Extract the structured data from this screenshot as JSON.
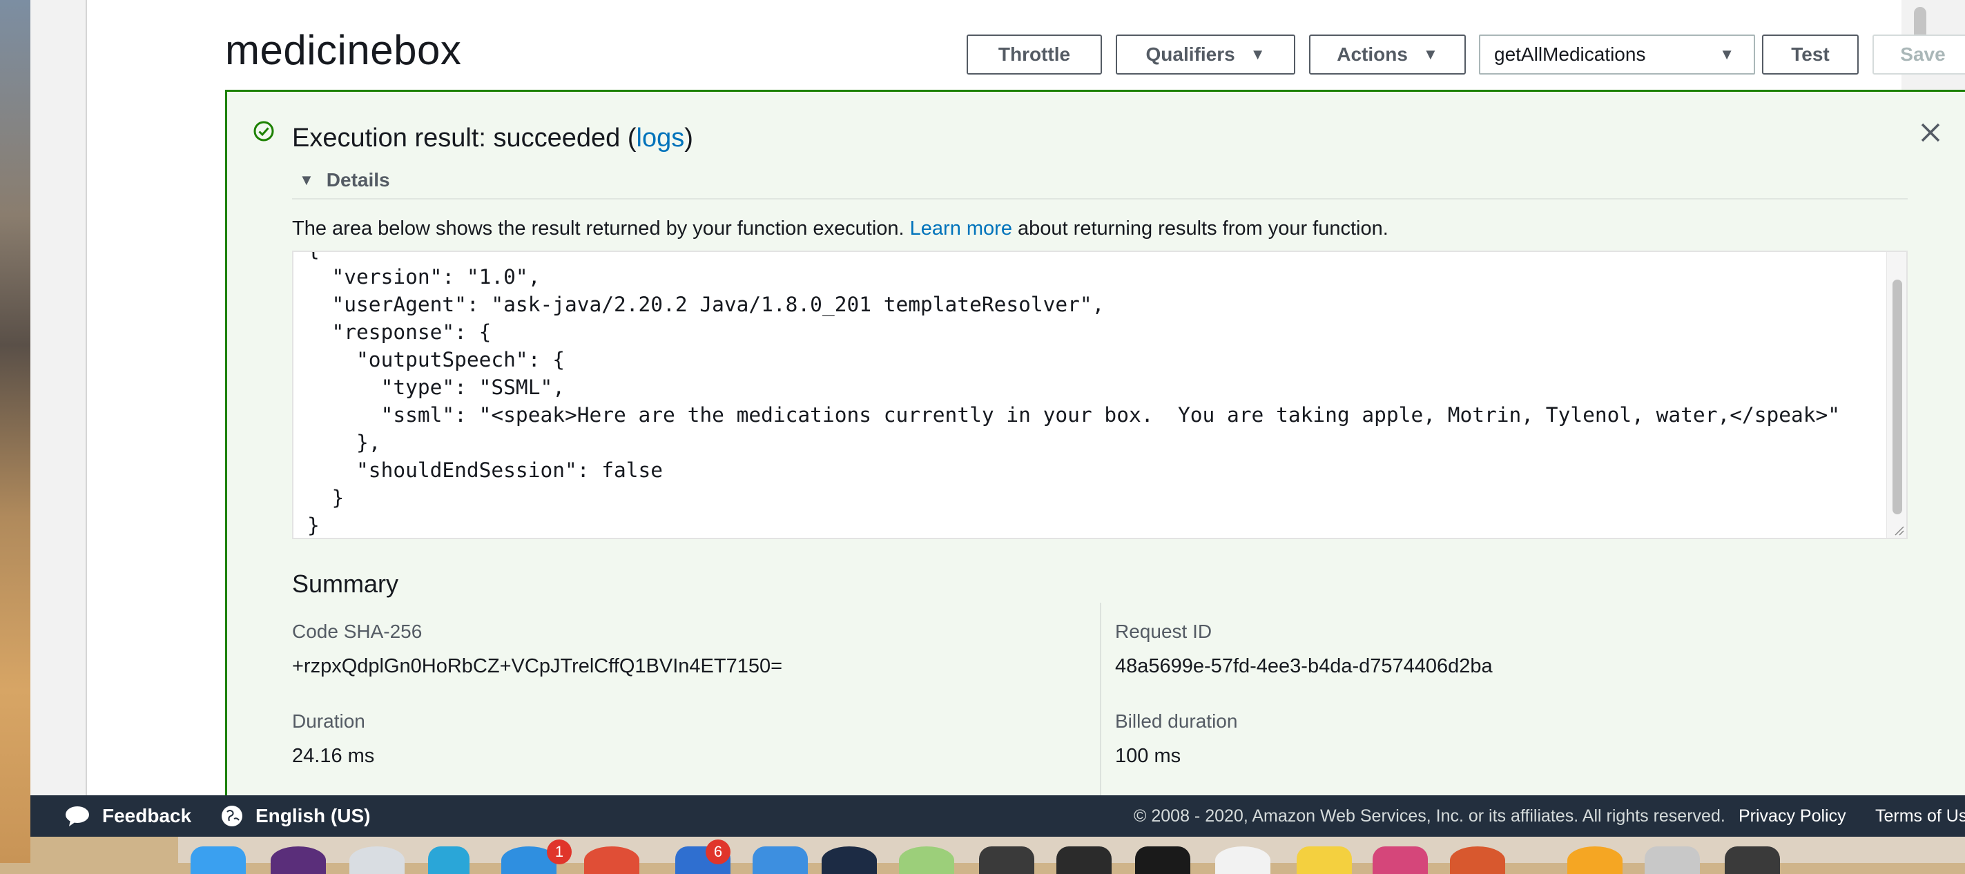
{
  "function": {
    "name": "medicinebox"
  },
  "toolbar": {
    "throttle_label": "Throttle",
    "qualifiers_label": "Qualifiers",
    "actions_label": "Actions",
    "test_event_selected": "getAllMedications",
    "test_label": "Test",
    "save_label": "Save"
  },
  "result": {
    "heading_prefix": "Execution result: succeeded (",
    "logs_link": "logs",
    "heading_suffix": ")",
    "details_label": "Details",
    "description_prefix": "The area below shows the result returned by your function execution. ",
    "learn_more": "Learn more",
    "description_suffix": " about returning results from your function.",
    "code_lines": [
      "{",
      "  \"version\": \"1.0\",",
      "  \"userAgent\": \"ask-java/2.20.2 Java/1.8.0_201 templateResolver\",",
      "  \"response\": {",
      "    \"outputSpeech\": {",
      "      \"type\": \"SSML\",",
      "      \"ssml\": \"<speak>Here are the medications currently in your box.  You are taking apple, Motrin, Tylenol, water,</speak>\"",
      "    },",
      "    \"shouldEndSession\": false",
      "  }",
      "}"
    ]
  },
  "summary": {
    "title": "Summary",
    "code_sha_label": "Code SHA-256",
    "code_sha_value": "+rzpxQdplGn0HoRbCZ+VCpJTrelCffQ1BVIn4ET7150=",
    "request_id_label": "Request ID",
    "request_id_value": "48a5699e-57fd-4ee3-b4da-d7574406d2ba",
    "duration_label": "Duration",
    "duration_value": "24.16 ms",
    "billed_label": "Billed duration",
    "billed_value": "100 ms"
  },
  "footer": {
    "feedback": "Feedback",
    "language": "English (US)",
    "copyright": "© 2008 - 2020, Amazon Web Services, Inc. or its affiliates. All rights reserved.",
    "privacy": "Privacy Policy",
    "terms": "Terms of Us"
  },
  "dock": {
    "badges": [
      "1",
      "6"
    ]
  },
  "colors": {
    "success": "#1d8102",
    "link": "#0073bb",
    "footer_bg": "#232f3e"
  }
}
